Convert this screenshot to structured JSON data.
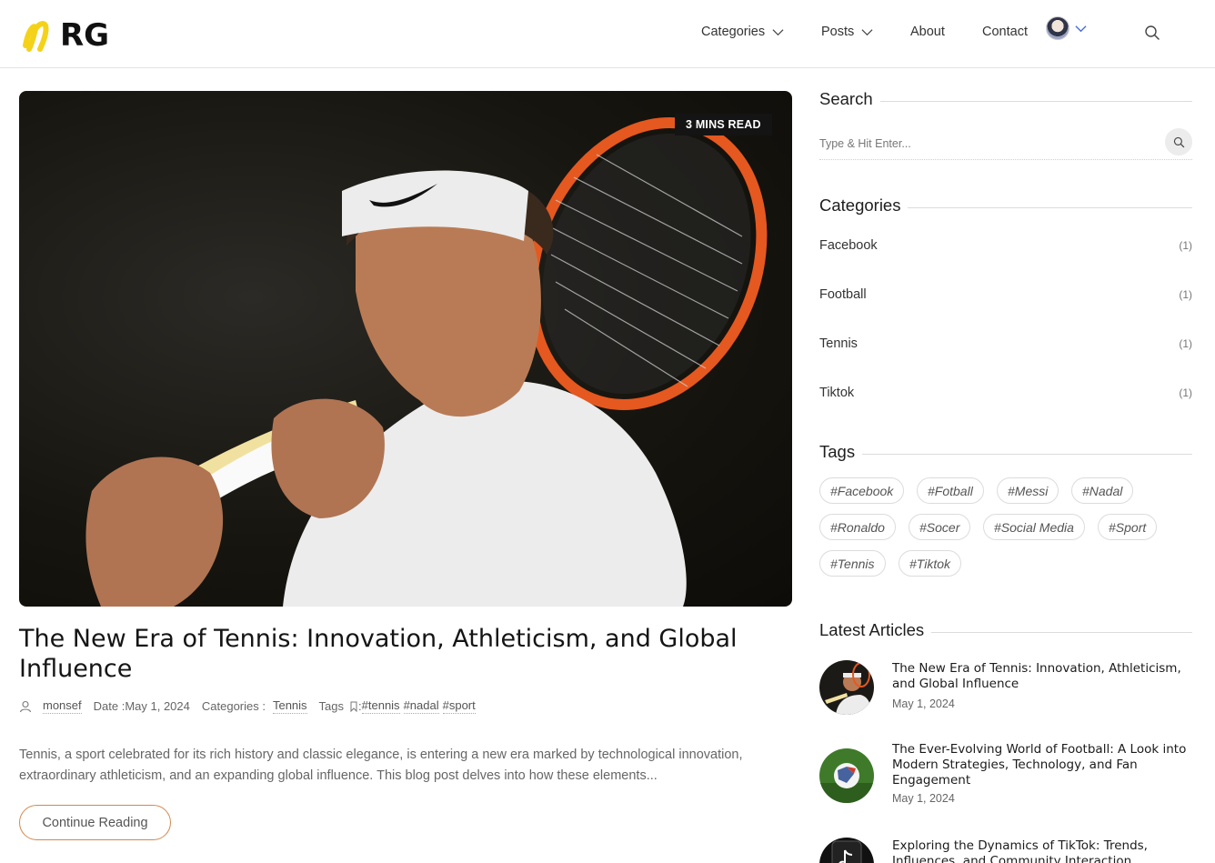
{
  "header": {
    "logo_text": "nRG",
    "nav": {
      "categories": "Categories",
      "posts": "Posts",
      "about": "About",
      "contact": "Contact"
    }
  },
  "hero": {
    "badge": "3 MINS READ"
  },
  "post": {
    "title": "The New Era of Tennis: Innovation, Athleticism, and Global Influence",
    "author": "monsef",
    "date_label": "Date : ",
    "date": "May 1, 2024",
    "categories_label": "Categories : ",
    "category": "Tennis",
    "tags_label": "Tags",
    "tags_sep": " : ",
    "tags": [
      "#tennis",
      "#nadal",
      "#sport"
    ],
    "excerpt": "Tennis, a sport celebrated for its rich history and classic elegance, is entering a new era marked by technological innovation, extraordinary athleticism, and an expanding global influence. This blog post delves into how these elements...",
    "continue_label": "Continue Reading"
  },
  "sidebar": {
    "search": {
      "title": "Search",
      "placeholder": "Type & Hit Enter..."
    },
    "categories": {
      "title": "Categories",
      "items": [
        {
          "name": "Facebook",
          "count": "(1)"
        },
        {
          "name": "Football",
          "count": "(1)"
        },
        {
          "name": "Tennis",
          "count": "(1)"
        },
        {
          "name": "Tiktok",
          "count": "(1)"
        }
      ]
    },
    "tags": {
      "title": "Tags",
      "items": [
        "#Facebook",
        "#Fotball",
        "#Messi",
        "#Nadal",
        "#Ronaldo",
        "#Socer",
        "#Social Media",
        "#Sport",
        "#Tennis",
        "#Tiktok"
      ]
    },
    "latest": {
      "title": "Latest Articles",
      "items": [
        {
          "title": "The New Era of Tennis: Innovation, Athleticism, and Global Influence",
          "date": "May 1, 2024"
        },
        {
          "title": "The Ever-Evolving World of Football: A Look into Modern Strategies, Technology, and Fan Engagement",
          "date": "May 1, 2024"
        },
        {
          "title": "Exploring the Dynamics of TikTok: Trends, Influences, and Community Interaction",
          "date": ""
        }
      ]
    }
  },
  "colors": {
    "accent_border": "#d4884f",
    "logo_yellow": "#f5d21a"
  }
}
